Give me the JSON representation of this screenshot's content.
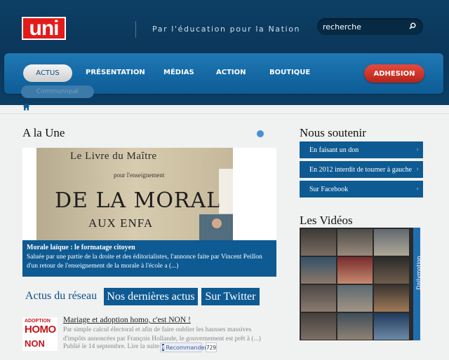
{
  "header": {
    "logo_text": "uni",
    "tagline": "Par l'éducation pour la Nation",
    "search_placeholder": "recherche"
  },
  "nav": {
    "items": [
      {
        "label": "ACTUS"
      },
      {
        "label": "PRÉSENTATION"
      },
      {
        "label": "MÉDIAS"
      },
      {
        "label": "ACTION"
      },
      {
        "label": "BOUTIQUE"
      },
      {
        "label": "ADHESION"
      }
    ],
    "hover_ghost": "Communiqué"
  },
  "une": {
    "heading": "A la Une",
    "image_text": {
      "line1": "Le Livre du Maître",
      "line2": "pour l'enseignement",
      "line3": "DE LA MORAL",
      "line4": "AUX ENFA"
    },
    "caption_title": "Morale laïque : le formatage citoyen",
    "caption_text": "Saluée par une partie de la droite et des éditorialistes, l'annonce faite par Vincent Peillon d'un retour de l'enseignement de la morale à l'école a (...)"
  },
  "tabs": {
    "reseau": "Actus du réseau",
    "dernieres": "Nos dernières actus",
    "twitter": "Sur Twitter"
  },
  "article": {
    "thumb_l1": "ADOPTION",
    "thumb_l2": "HOMO",
    "thumb_l3": "NON",
    "title": "Mariage et adoption homo, c'est NON !",
    "text": "Par simple calcul électoral et afin de faire oublier les hausses massives d'impôts annoncées par François Hollande, le gouvernement est prêt à (...)",
    "date": "Publié le 14 septembre. Lire la suite",
    "fb_label": "Recommander",
    "fb_count": "729"
  },
  "soutenir": {
    "heading": "Nous soutenir",
    "links": [
      {
        "label": "En faisant un don"
      },
      {
        "label": "En 2012 interdit de tourner à gauche"
      },
      {
        "label": "Sur Facebook"
      }
    ]
  },
  "videos": {
    "heading": "Les Vidéos",
    "brand": "Dailymotion"
  },
  "colors": {
    "header_bg": "#0a3659",
    "nav_blue": "#1f78b4",
    "dark_blue": "#0e5a92",
    "red_accent": "#c9291f"
  }
}
